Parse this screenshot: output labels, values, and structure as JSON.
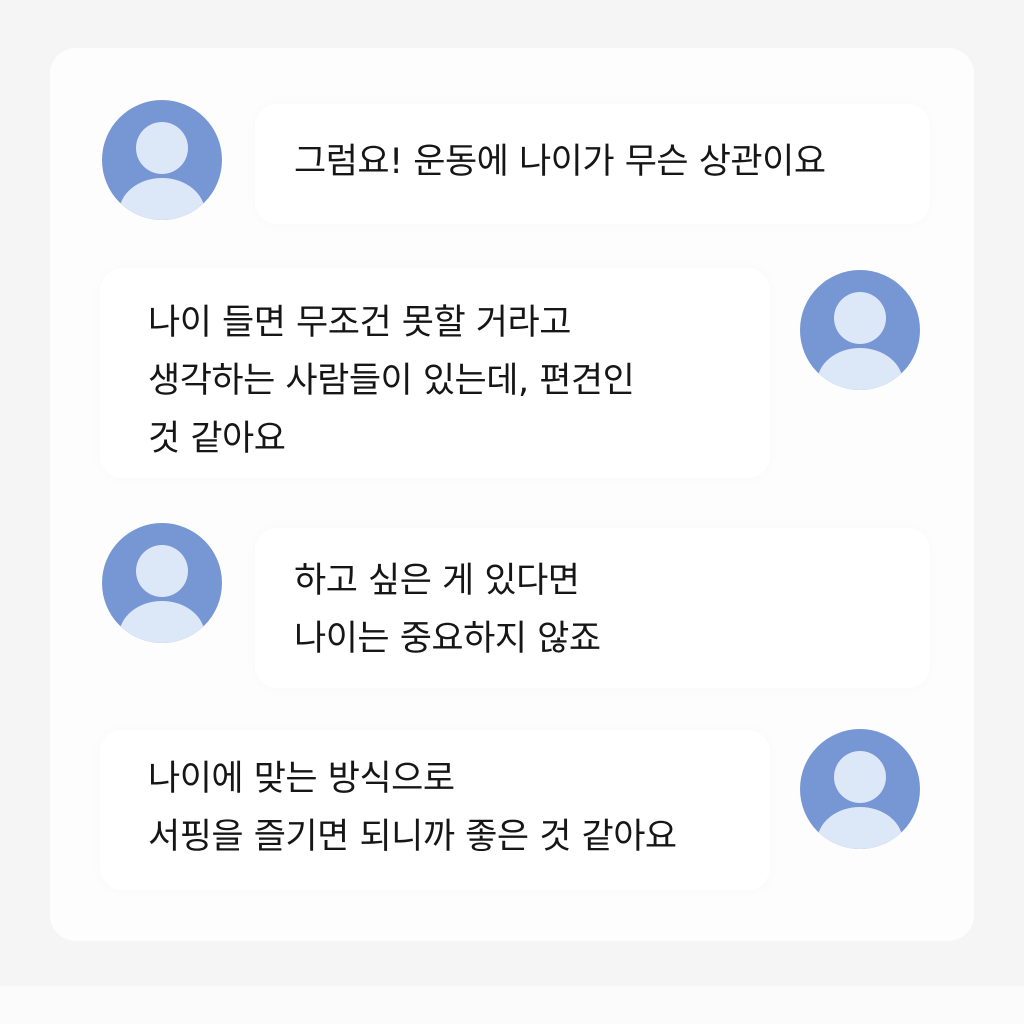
{
  "messages": [
    {
      "side": "left",
      "text": "그럼요! 운동에 나이가 무슨 상관이요",
      "avatar_icon": "user-avatar-icon"
    },
    {
      "side": "right",
      "text": "나이 들면 무조건 못할 거라고\n생각하는 사람들이 있는데, 편견인\n것 같아요",
      "avatar_icon": "user-avatar-icon"
    },
    {
      "side": "left",
      "text": "하고 싶은 게 있다면\n나이는 중요하지 않죠",
      "avatar_icon": "user-avatar-icon"
    },
    {
      "side": "right",
      "text": "나이에 맞는 방식으로\n서핑을 즐기면 되니까 좋은 것 같아요",
      "avatar_icon": "user-avatar-icon"
    }
  ],
  "colors": {
    "avatar": "#7797d4",
    "avatar_figure": "#dce7f8",
    "bubble": "#ffffff",
    "panel": "#fdfdfd",
    "background": "#f5f5f6",
    "text": "#161616"
  }
}
